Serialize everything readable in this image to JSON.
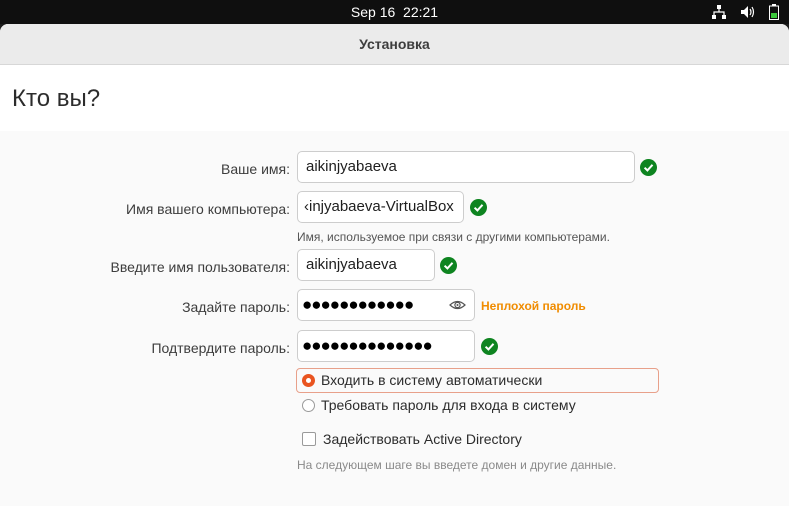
{
  "topbar": {
    "date": "Sep 16",
    "time": "22:21"
  },
  "window": {
    "title": "Установка"
  },
  "page": {
    "title": "Кто вы?"
  },
  "form": {
    "name": {
      "label": "Ваше имя:",
      "value": "aikinjyabaeva"
    },
    "computer": {
      "label": "Имя вашего компьютера:",
      "value": "‹injyabaeva-VirtualBox",
      "hint": "Имя, используемое при связи с другими компьютерами."
    },
    "username": {
      "label": "Введите имя пользователя:",
      "value": "aikinjyabaeva"
    },
    "password": {
      "label": "Задайте пароль:",
      "strength": "Неплохой пароль"
    },
    "confirm": {
      "label": "Подтвердите пароль:"
    },
    "login_auto": "Входить в систему автоматически",
    "login_password": "Требовать пароль для входа в систему",
    "active_directory": "Задействовать Active Directory",
    "ad_hint": "На следующем шаге вы введете домен и другие данные."
  },
  "colors": {
    "accent": "#e95420",
    "ok": "#0e8420",
    "strength": "#f08c00"
  }
}
